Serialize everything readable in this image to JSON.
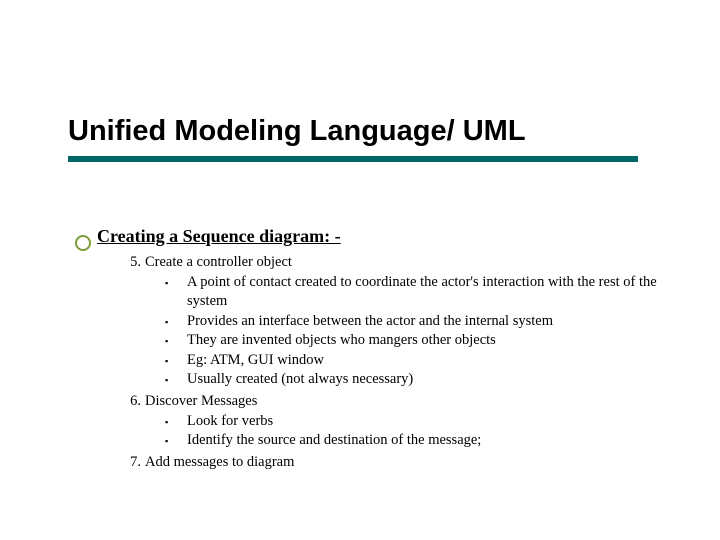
{
  "title": "Unified Modeling Language/ UML",
  "section_heading": "Creating a Sequence diagram: -",
  "items": [
    {
      "num": "5.",
      "text": "Create a controller object",
      "sub": [
        "A point of contact created to coordinate the actor's interaction with the rest of the system",
        "Provides an interface between the actor and the internal system",
        "They are invented objects who mangers other objects",
        "Eg: ATM, GUI window",
        "Usually created (not always necessary)"
      ]
    },
    {
      "num": "6.",
      "text": "Discover Messages",
      "sub": [
        "Look for verbs",
        "Identify the source and destination of the message;"
      ]
    },
    {
      "num": "7.",
      "text": "Add messages to diagram",
      "sub": []
    }
  ]
}
